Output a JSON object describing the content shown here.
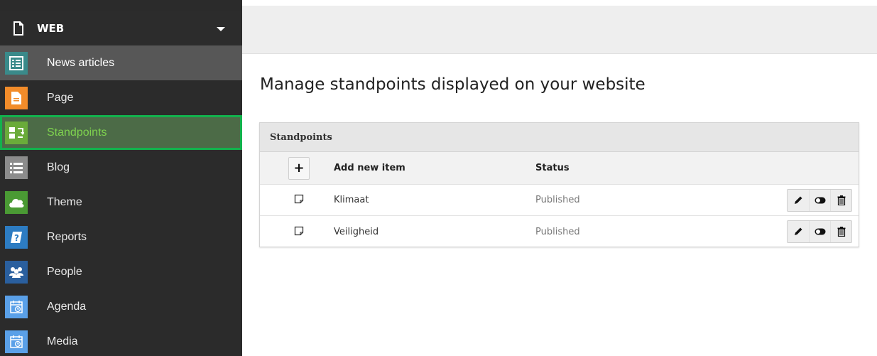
{
  "header": {
    "title": "WEB"
  },
  "sidebar": {
    "items": [
      {
        "label": "News articles",
        "icon": "list-icon",
        "color": "#3a8a8a"
      },
      {
        "label": "Page",
        "icon": "page-icon",
        "color": "#f28c2a"
      },
      {
        "label": "Standpoints",
        "icon": "standpoints-icon",
        "color": "#6aab3a"
      },
      {
        "label": "Blog",
        "icon": "blog-list-icon",
        "color": "#8c8c8c"
      },
      {
        "label": "Theme",
        "icon": "cloud-icon",
        "color": "#4a9a34"
      },
      {
        "label": "Reports",
        "icon": "reports-icon",
        "color": "#2d7cc2"
      },
      {
        "label": "People",
        "icon": "people-icon",
        "color": "#2a5f9e"
      },
      {
        "label": "Agenda",
        "icon": "calendar-icon",
        "color": "#5aa0e8"
      },
      {
        "label": "Media",
        "icon": "calendar-icon",
        "color": "#5aa0e8"
      }
    ]
  },
  "main": {
    "title": "Manage standpoints displayed on your website",
    "panel": {
      "heading": "Standpoints",
      "columns": {
        "add": "+",
        "title": "Add new item",
        "status": "Status"
      },
      "rows": [
        {
          "title": "Klimaat",
          "status": "Published"
        },
        {
          "title": "Veiligheid",
          "status": "Published"
        }
      ]
    }
  },
  "colors": {
    "sidebar_bg": "#2b2b2b",
    "active_outline": "#12b24d",
    "active_text": "#7fd34f"
  }
}
